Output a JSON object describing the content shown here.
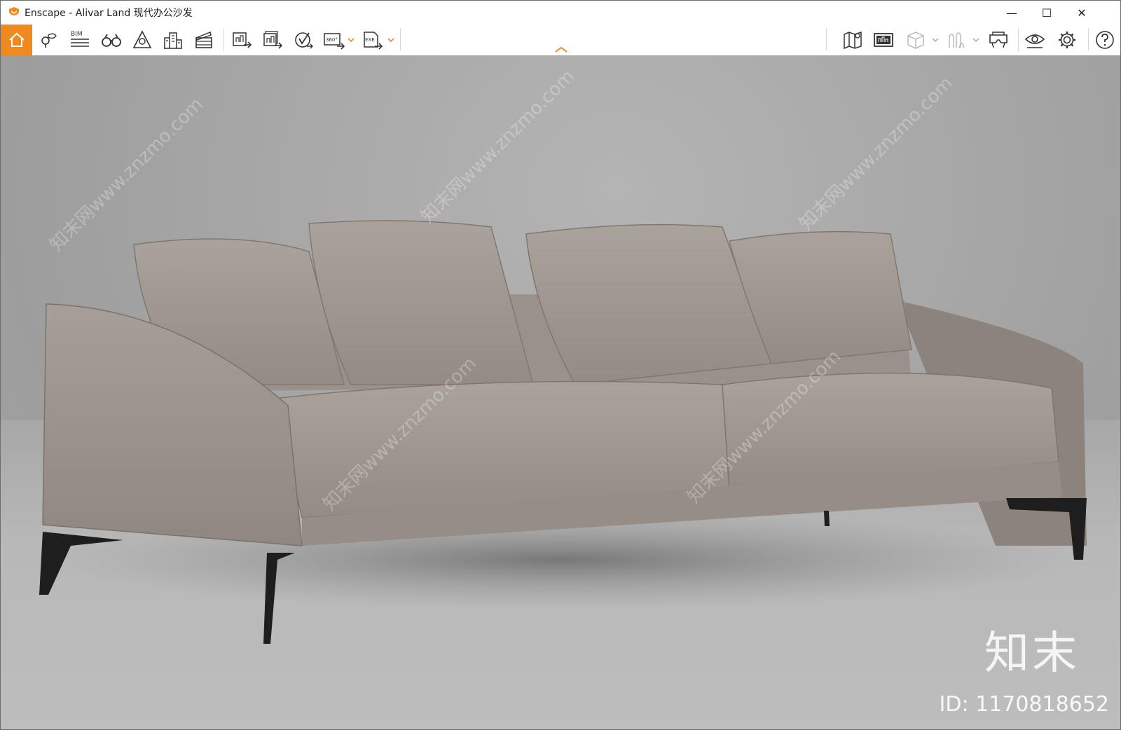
{
  "window": {
    "title": "Enscape - Alivar Land 现代办公沙发",
    "minimize_icon": "minimize-icon",
    "maximize_icon": "maximize-icon",
    "close_icon": "close-icon",
    "minimize_glyph": "—",
    "maximize_glyph": "☐",
    "close_glyph": "✕"
  },
  "toolbar": {
    "left_icons": [
      "home-icon",
      "location-pin-icon",
      "bim-icon",
      "binoculars-icon",
      "view-icon",
      "buildings-icon",
      "clapperboard-icon",
      "screenshot-export-icon",
      "batch-export-icon",
      "panorama-icon",
      "360-export-icon",
      "exe-export-icon"
    ],
    "bim_label": "BIM",
    "pano_label": "360°",
    "exe_label": "EXE",
    "right_icons": [
      "map-icon",
      "billboard-icon",
      "box-icon",
      "assets-icon",
      "vr-headset-icon",
      "visibility-icon",
      "settings-icon",
      "help-icon"
    ],
    "collapse_icon": "chevron-up-icon",
    "accent_color": "#f08a1f"
  },
  "viewport": {
    "watermark_text": "知末网www.znzmo.com",
    "brand_text": "知末",
    "image_id": "ID: 1170818652"
  }
}
